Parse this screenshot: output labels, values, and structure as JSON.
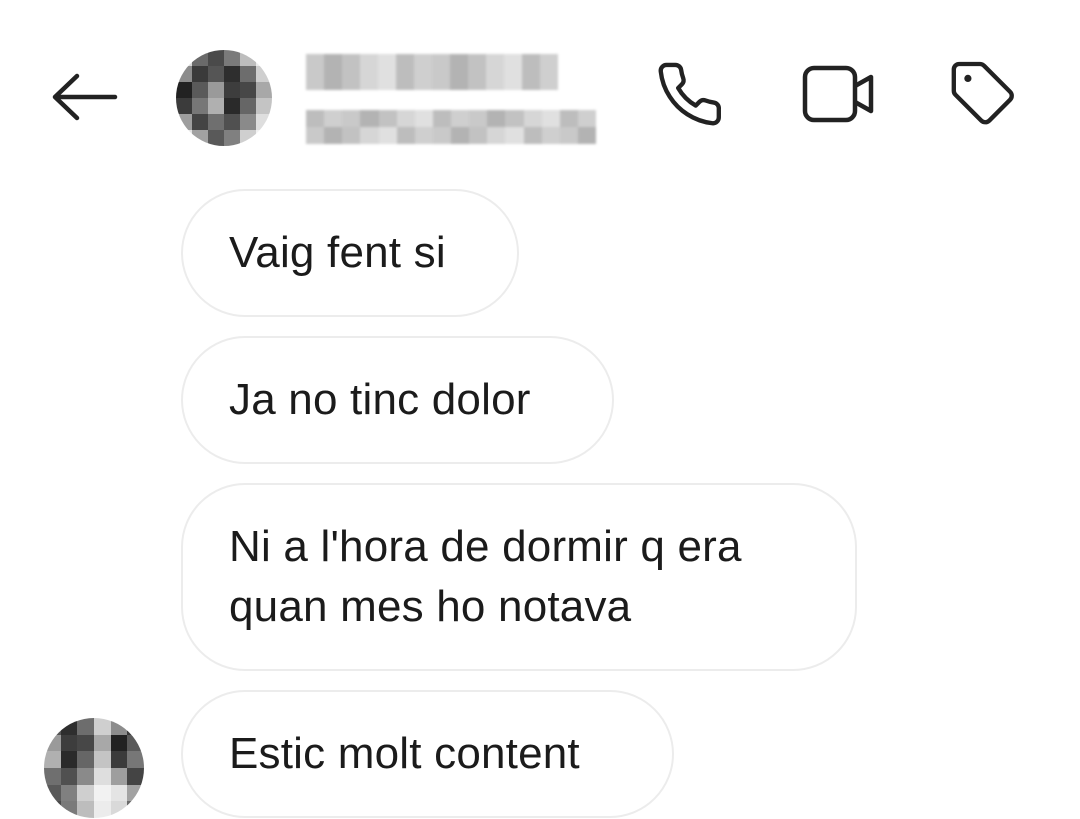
{
  "header": {
    "contact_name": "",
    "contact_status": "",
    "icons": {
      "back": "back-arrow-icon",
      "phone": "phone-icon",
      "video": "video-camera-icon",
      "tag": "tag-icon"
    }
  },
  "messages": [
    {
      "text": "Vaig fent si"
    },
    {
      "text": "Ja no tinc dolor"
    },
    {
      "text": "Ni a l'hora de dormir q era\nquan mes ho notava"
    },
    {
      "text": "Estic molt content"
    }
  ],
  "colors": {
    "background": "#ffffff",
    "bubble_border": "#ececec",
    "text": "#1b1b1b",
    "icon": "#222222"
  }
}
